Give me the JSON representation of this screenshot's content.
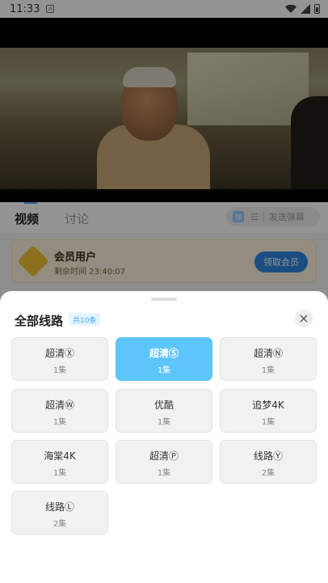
{
  "status_bar": {
    "time": "11:33",
    "sim_label": "A"
  },
  "tabs": {
    "video": "视频",
    "discuss": "讨论"
  },
  "danmu": {
    "icon_label": "弹",
    "settings_label": "☰",
    "send_label": "发送弹幕"
  },
  "vip": {
    "title": "会员用户",
    "remaining": "剩余时间 23:40:07",
    "button": "领取会员"
  },
  "sheet": {
    "title": "全部线路",
    "count": "共10条",
    "lines": [
      {
        "name": "超清Ⓧ",
        "eps": "1集",
        "active": false
      },
      {
        "name": "超清Ⓢ",
        "eps": "1集",
        "active": true
      },
      {
        "name": "超清Ⓝ",
        "eps": "1集",
        "active": false
      },
      {
        "name": "超清Ⓦ",
        "eps": "1集",
        "active": false
      },
      {
        "name": "优酷",
        "eps": "1集",
        "active": false
      },
      {
        "name": "追梦4K",
        "eps": "1集",
        "active": false
      },
      {
        "name": "海棠4K",
        "eps": "1集",
        "active": false
      },
      {
        "name": "超清Ⓟ",
        "eps": "1集",
        "active": false
      },
      {
        "name": "线路Ⓨ",
        "eps": "2集",
        "active": false
      },
      {
        "name": "线路Ⓛ",
        "eps": "2集",
        "active": false
      }
    ]
  },
  "colors": {
    "accent": "#3ea8ff",
    "active_cell": "#5ec5fb",
    "vip_button": "#2f86de"
  },
  "icons": {
    "close": "close-icon",
    "wifi": "wifi-icon",
    "signal": "signal-icon",
    "battery": "battery-icon"
  }
}
